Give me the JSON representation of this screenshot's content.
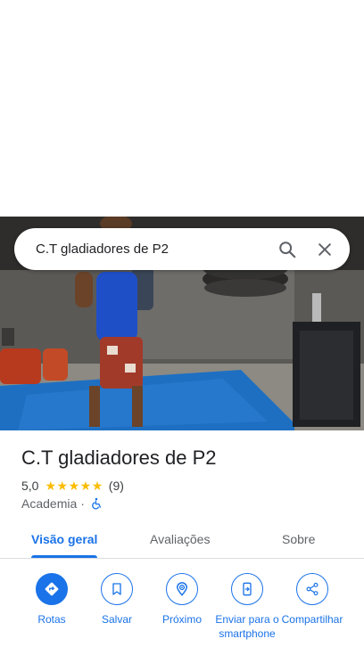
{
  "search": {
    "query": "C.T gladiadores de P2"
  },
  "place": {
    "name": "C.T gladiadores de P2",
    "rating": "5,0",
    "stars_count": 5,
    "review_count": "(9)",
    "category": "Academia",
    "separator": "·"
  },
  "tabs": [
    {
      "label": "Visão geral",
      "active": true
    },
    {
      "label": "Avaliações",
      "active": false
    },
    {
      "label": "Sobre",
      "active": false
    }
  ],
  "actions": [
    {
      "label": "Rotas",
      "icon": "directions-icon"
    },
    {
      "label": "Salvar",
      "icon": "bookmark-icon"
    },
    {
      "label": "Próximo",
      "icon": "nearby-icon"
    },
    {
      "label": "Enviar para o smartphone",
      "icon": "send-to-phone-icon"
    },
    {
      "label": "Compartilhar",
      "icon": "share-icon"
    }
  ],
  "colors": {
    "accent": "#1a73e8",
    "star": "#fbbc04",
    "mat": "#1e6fc2"
  }
}
